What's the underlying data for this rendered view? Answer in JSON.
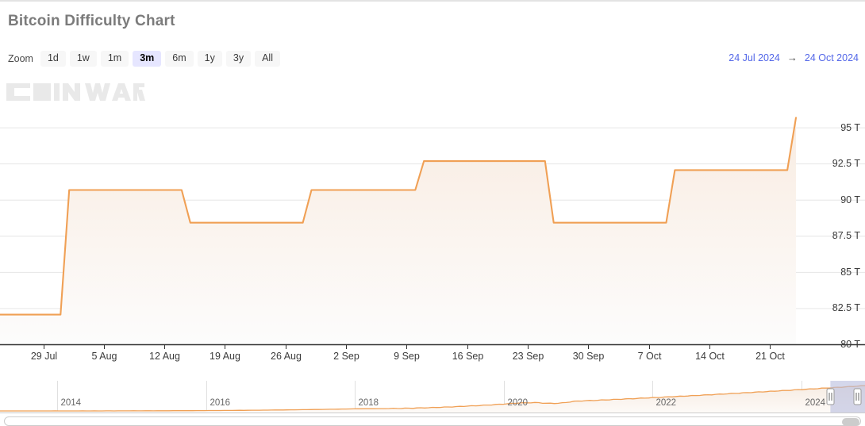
{
  "header": {
    "title": "Bitcoin Difficulty Chart"
  },
  "range_selector": {
    "label": "Zoom",
    "buttons": [
      {
        "label": "1d",
        "selected": false
      },
      {
        "label": "1w",
        "selected": false
      },
      {
        "label": "1m",
        "selected": false
      },
      {
        "label": "3m",
        "selected": true
      },
      {
        "label": "6m",
        "selected": false
      },
      {
        "label": "1y",
        "selected": false
      },
      {
        "label": "3y",
        "selected": false
      },
      {
        "label": "All",
        "selected": false
      }
    ]
  },
  "date_range": {
    "from": "24 Jul 2024",
    "arrow": "→",
    "to": "24 Oct 2024"
  },
  "watermark": {
    "text": "CoinWarz",
    "color": "#e8e8e8"
  },
  "colors": {
    "line": "#f0a055",
    "fill_top": "#faeee4",
    "fill_bottom": "#fbfbfb",
    "grid": "#e6e6e6",
    "axis": "#333333",
    "accent": "#5266e8",
    "selected_button_bg": "#e6e6ff",
    "navigator_mask": "#b9bde3"
  },
  "chart_data": {
    "type": "line",
    "title": "Bitcoin Difficulty Chart",
    "subtitle": "",
    "xlabel": "",
    "ylabel": "",
    "ylim": [
      80,
      95.8
    ],
    "xlim": [
      "24 Jul 2024",
      "24 Oct 2024"
    ],
    "grid": true,
    "legend": null,
    "unit": "T",
    "y_ticks": [
      95,
      92.5,
      90,
      87.5,
      85,
      82.5,
      80
    ],
    "y_tick_labels": [
      "95 T",
      "92.5 T",
      "90 T",
      "87.5 T",
      "85 T",
      "82.5 T",
      "80 T"
    ],
    "x_ticks": [
      "29 Jul",
      "5 Aug",
      "12 Aug",
      "19 Aug",
      "26 Aug",
      "2 Sep",
      "9 Sep",
      "16 Sep",
      "23 Sep",
      "30 Sep",
      "7 Oct",
      "14 Oct",
      "21 Oct"
    ],
    "series": [
      {
        "name": "Bitcoin Difficulty",
        "points": [
          {
            "date": "24 Jul 2024",
            "value": 82.05
          },
          {
            "date": "31 Jul 2024",
            "value": 82.05
          },
          {
            "date": "1 Aug 2024",
            "value": 90.67
          },
          {
            "date": "14 Aug 2024",
            "value": 90.67
          },
          {
            "date": "15 Aug 2024",
            "value": 88.41
          },
          {
            "date": "28 Aug 2024",
            "value": 88.41
          },
          {
            "date": "29 Aug 2024",
            "value": 90.67
          },
          {
            "date": "10 Sep 2024",
            "value": 90.67
          },
          {
            "date": "11 Sep 2024",
            "value": 92.67
          },
          {
            "date": "25 Sep 2024",
            "value": 92.67
          },
          {
            "date": "26 Sep 2024",
            "value": 88.41
          },
          {
            "date": "9 Oct 2024",
            "value": 88.41
          },
          {
            "date": "10 Oct 2024",
            "value": 92.05
          },
          {
            "date": "23 Oct 2024",
            "value": 92.05
          },
          {
            "date": "24 Oct 2024",
            "value": 95.67
          }
        ]
      }
    ],
    "navigator": {
      "year_labels": [
        "2014",
        "2016",
        "2018",
        "2020",
        "2022",
        "2024"
      ],
      "selection": {
        "start_pct": 96.0,
        "end_pct": 100.0
      }
    }
  }
}
